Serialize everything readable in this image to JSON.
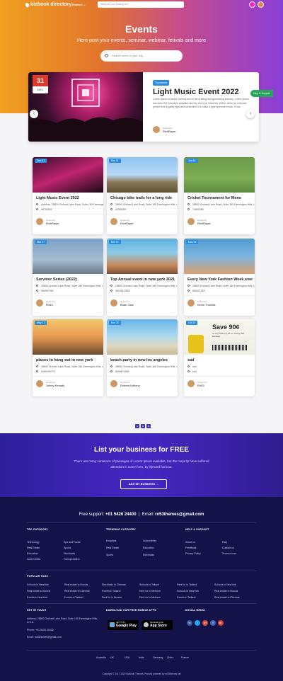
{
  "header": {
    "logo": "bizbook directory",
    "explore": "Explore",
    "search_placeholder": "What are you looking for?"
  },
  "hero": {
    "title": "Events",
    "subtitle": "Here post your events, seminar, webinar, fetivals and more",
    "search_placeholder": "Search event in your city..."
  },
  "featured": {
    "day": "31",
    "month": "DEC",
    "tag": "Top events",
    "title": "Light Music Event 2022",
    "description": "Lorem Ipsum is simply dummy text of the printing and typesetting industry. Lorem Ipsum has been the industry's standard dummy text ever since the 1500s, when an unknown printer took a galley type and scrambled it to make a type specimen book. It has",
    "host_label": "Hosted by",
    "host_name": "RichRayer"
  },
  "help": "Help & Support",
  "cards": [
    {
      "badge": "Dec 31",
      "title": "Light Music Event 2022",
      "address": "Address: 28800 Orchard Lake Road, Suite 180 Farmington Hills, U.S.A.",
      "phone": "98765432",
      "host_label": "Hosted by",
      "host": "RichRayer",
      "bg": "linear-gradient(160deg,#3a0f2e,#c0246f 50%,#1a0a16)"
    },
    {
      "badge": "Mar 11",
      "title": "Chicago bike trails for a long ride",
      "address": "28800 Orchard Lake Road, Suite 180 Farmington Hills, U.S.A.",
      "phone": "64351892",
      "host_label": "Hosted by",
      "host": "RichRayer",
      "bg": "linear-gradient(180deg,#8fc3f0 0%,#b7d9f5 50%,#8a7a5a 70%,#5d4f33 100%)"
    },
    {
      "badge": "Jun 16",
      "title": "Cricket Tournament for Mens",
      "address": "28800 Orchard Lake Road, Suite 180 Farmington Hills, U.S.A.",
      "phone": "74651986",
      "host_label": "Hosted by",
      "host": "RichRayer",
      "bg": "linear-gradient(180deg,#6b9a4a 0%,#7fae55 60%,#5c8a3d 100%)"
    },
    {
      "badge": "Mar 17",
      "title": "Survivor Series (2022)",
      "address": "28800 Orchard Lake Road, Suite 180 Farmington Hills, U.S.A.",
      "phone": "55496795​4",
      "host_label": "Hosted by",
      "host": "Rn53",
      "bg": "linear-gradient(180deg,#7aa0c8 0%,#a8bcd0 60%,#6a7a8a 100%)"
    },
    {
      "badge": "Mar 07",
      "title": "Top Annual  event in new york 2021",
      "address": "28800 Orchard Lake Road, Suite 180 Farmington Hills, U.S.A.",
      "phone": "06245123621",
      "host_label": "Hosted by",
      "host": "Brian Jose",
      "bg": "linear-gradient(180deg,#5fb0e0 0%,#8ecbe8 40%,#c88a5a 75%,#7a4f36 100%)"
    },
    {
      "badge": "May 06",
      "title": "Every New York Fashion Week event",
      "address": "28800 Orchard Lake Road, Suite 180 Farmington Hills, U.S.A.",
      "phone": "56542136​3",
      "host_label": "Hosted by",
      "host": "Kevin Thomas",
      "bg": "linear-gradient(180deg,#4f9ad0 0%,#7cb6e0 50%,#d8a070 100%)"
    },
    {
      "badge": "May 17",
      "title": "places to hang out in new york",
      "address": "28800 Orchard Lake Road, Suite 180 Farmington Hills, U.S.A.",
      "phone": "8465435778",
      "host_label": "Hosted by",
      "host": "Joiney Kenady",
      "bg": "linear-gradient(180deg,#f2c66a 0%,#e89a50 50%,#6a4a30 100%)"
    },
    {
      "badge": "Nov 20",
      "title": "beach party in new los angeles",
      "address": "28800 Orchard Lake Road, Suite 180 Farmington Hills, U.S.A.",
      "phone": "65456718​08",
      "host_label": "Hosted by",
      "host": "Robert Anthony",
      "bg": "linear-gradient(180deg,#6ab4e8 0%,#a8d8f0 45%,#e0d8c0 75%,#c8b898 100%)"
    },
    {
      "badge": "Oct 20",
      "title": "sad",
      "address": "dsd",
      "phone": "sdd",
      "host_label": "Hosted by",
      "host": "Rn53",
      "bg": "linear-gradient(180deg,#f7f7f0 0%,#eeeee0 100%)"
    }
  ],
  "coupon": {
    "price": "Save 90¢",
    "line": "on any ONE (1) 16 oz. Jimmy dell sausage"
  },
  "pagination": [
    "1",
    "2",
    "3"
  ],
  "business": {
    "title": "List your business for FREE",
    "description": "There are many variations of passages of Lorem Ipsum available, but the majority have suffered alteration in some form, by injected humour.",
    "button": "ADD MY BUSINESS"
  },
  "footer": {
    "support_label": "Free support:",
    "phone": "+01 5426 24400",
    "email_label": "Email:",
    "email": "rn53themes@gmail.com",
    "top_category": {
      "title": "TOP CATEGORY",
      "items": [
        "Technology",
        "Spa and Facial",
        "Real Estate",
        "Sports",
        "Education",
        "Electricals",
        "Automobiles",
        "Transportation"
      ]
    },
    "trending": {
      "title": "TRENDING CATEGORY",
      "items": [
        "Hospitals",
        "Automobiles",
        "Real Estate",
        "Education",
        "Sports",
        "Electricals"
      ]
    },
    "help": {
      "title": "HELP & SUPPORT",
      "items": [
        "About us",
        "FAQ",
        "Feedback",
        "Contact us",
        "Privacy Policy",
        "Terms of use"
      ]
    },
    "popular_tags": {
      "title": "POPULAR TAGS",
      "items": [
        "Schools in NewYork",
        "Real estate in Illunois",
        "Electricals in Chennai",
        "Schools in Tailand",
        "Rent for in Tailand",
        "Schools in NewYork",
        "Real estate in Illunois",
        "Real estate in Chennai",
        "Events in Tailand",
        "Rent for in Melborn",
        "Schools in NewYork",
        "Real estate in Illunois",
        "Events in NewYork",
        "Events in Tailand",
        "Rent for in Illunois",
        "Rent for in Melborn",
        "Events in Tailand",
        "Real estate in Chennai"
      ]
    },
    "touch": {
      "title": "GET IN TOUCH",
      "address": "Address: 28800 Orchard Lake Road, Suite 180 Farmington Hills, U.S.A.",
      "phone": "Phone: +01 5426 24400",
      "email": "Email: rn53themes@gmail.com"
    },
    "apps": {
      "title": "DOWNLOAD OUR FREE MOBILE APPS",
      "google_small": "GET IT ON",
      "google": "Google Play",
      "apple_small": "Download on the",
      "apple": "App Store"
    },
    "social": {
      "title": "SOCIAL MEDIA",
      "colors": [
        "#3b5998",
        "#1da1f2",
        "#dd4b39",
        "#4267b2",
        "#e53935"
      ],
      "icons": [
        "in",
        "t",
        "g+",
        "f",
        "▶"
      ]
    },
    "countries": [
      "Australia",
      "UK",
      "USA",
      "India",
      "Germany",
      "China",
      "France"
    ],
    "copyright": "Copyright © 2017-2020 BizBook Themes. Proudly powered by rn53themes.net"
  }
}
